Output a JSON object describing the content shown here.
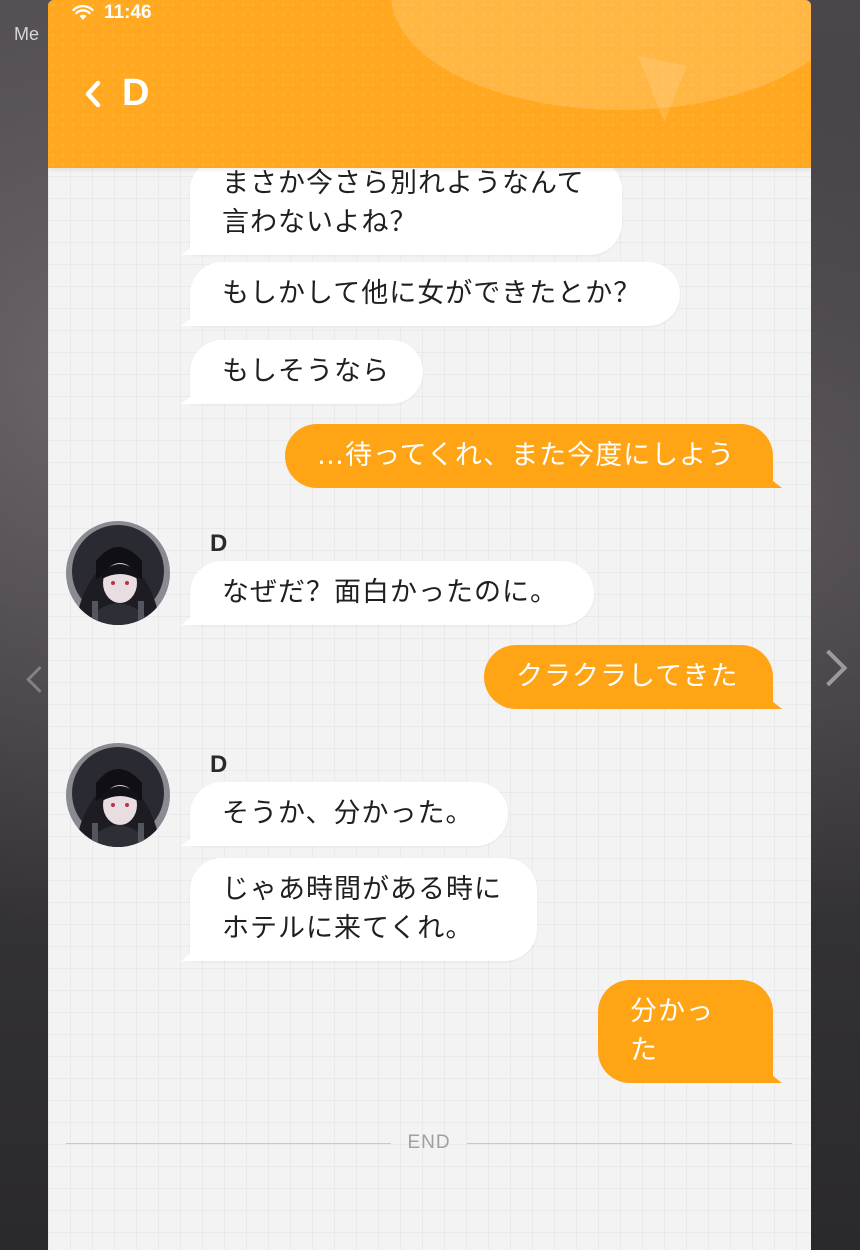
{
  "status_bar": {
    "time": "11:46"
  },
  "background": {
    "corner_text": "Me"
  },
  "header": {
    "title": "D"
  },
  "messages": [
    {
      "text": "まさか今さら別れようなんて\n言わないよね？",
      "side": "in"
    },
    {
      "text": "もしかして他に女ができたとか？",
      "side": "in"
    },
    {
      "text": "もしそうなら",
      "side": "in"
    },
    {
      "text": "…待ってくれ、また今度にしよう",
      "side": "out"
    },
    {
      "sender": "D",
      "text": "なぜだ？面白かったのに。",
      "side": "in"
    },
    {
      "text": "クラクラしてきた",
      "side": "out"
    },
    {
      "sender": "D",
      "text": "そうか、分かった。",
      "side": "in"
    },
    {
      "text": "じゃあ時間がある時に\nホテルに来てくれ。",
      "side": "in"
    },
    {
      "text": "分かった",
      "side": "out"
    }
  ],
  "footer": {
    "end_label": "END"
  },
  "colors": {
    "header": "#ffa820",
    "outgoing_bubble": "#ffa414",
    "incoming_bubble": "#ffffff",
    "chat_background": "#f3f3f3"
  }
}
